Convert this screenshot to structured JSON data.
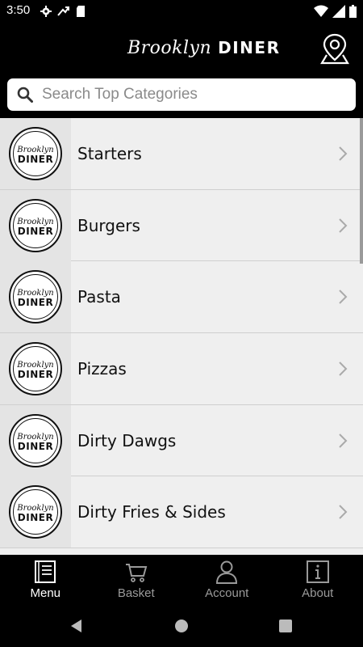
{
  "status_bar": {
    "time": "3:50",
    "left_icons": [
      "gear-icon",
      "missed-call-icon",
      "sd-card-icon"
    ],
    "right_icons": [
      "wifi-icon",
      "signal-icon",
      "battery-icon"
    ]
  },
  "header": {
    "brand_script": "Brooklyn",
    "brand_word": "DINER",
    "location_icon": "map-pin-icon"
  },
  "search": {
    "placeholder": "Search Top Categories",
    "value": ""
  },
  "categories": [
    {
      "label": "Starters",
      "logo_script": "Brooklyn",
      "logo_word": "DINER"
    },
    {
      "label": "Burgers",
      "logo_script": "Brooklyn",
      "logo_word": "DINER"
    },
    {
      "label": "Pasta",
      "logo_script": "Brooklyn",
      "logo_word": "DINER"
    },
    {
      "label": "Pizzas",
      "logo_script": "Brooklyn",
      "logo_word": "DINER"
    },
    {
      "label": "Dirty Dawgs",
      "logo_script": "Brooklyn",
      "logo_word": "DINER"
    },
    {
      "label": "Dirty Fries & Sides",
      "logo_script": "Brooklyn",
      "logo_word": "DINER"
    }
  ],
  "bottom_nav": {
    "items": [
      {
        "label": "Menu",
        "icon": "menu-book-icon",
        "active": true
      },
      {
        "label": "Basket",
        "icon": "cart-icon",
        "active": false
      },
      {
        "label": "Account",
        "icon": "user-icon",
        "active": false
      },
      {
        "label": "About",
        "icon": "info-icon",
        "active": false
      }
    ]
  },
  "colors": {
    "background": "#000000",
    "list_background": "#efefef",
    "active_nav": "#ffffff",
    "inactive_nav": "#9a9a9a"
  }
}
